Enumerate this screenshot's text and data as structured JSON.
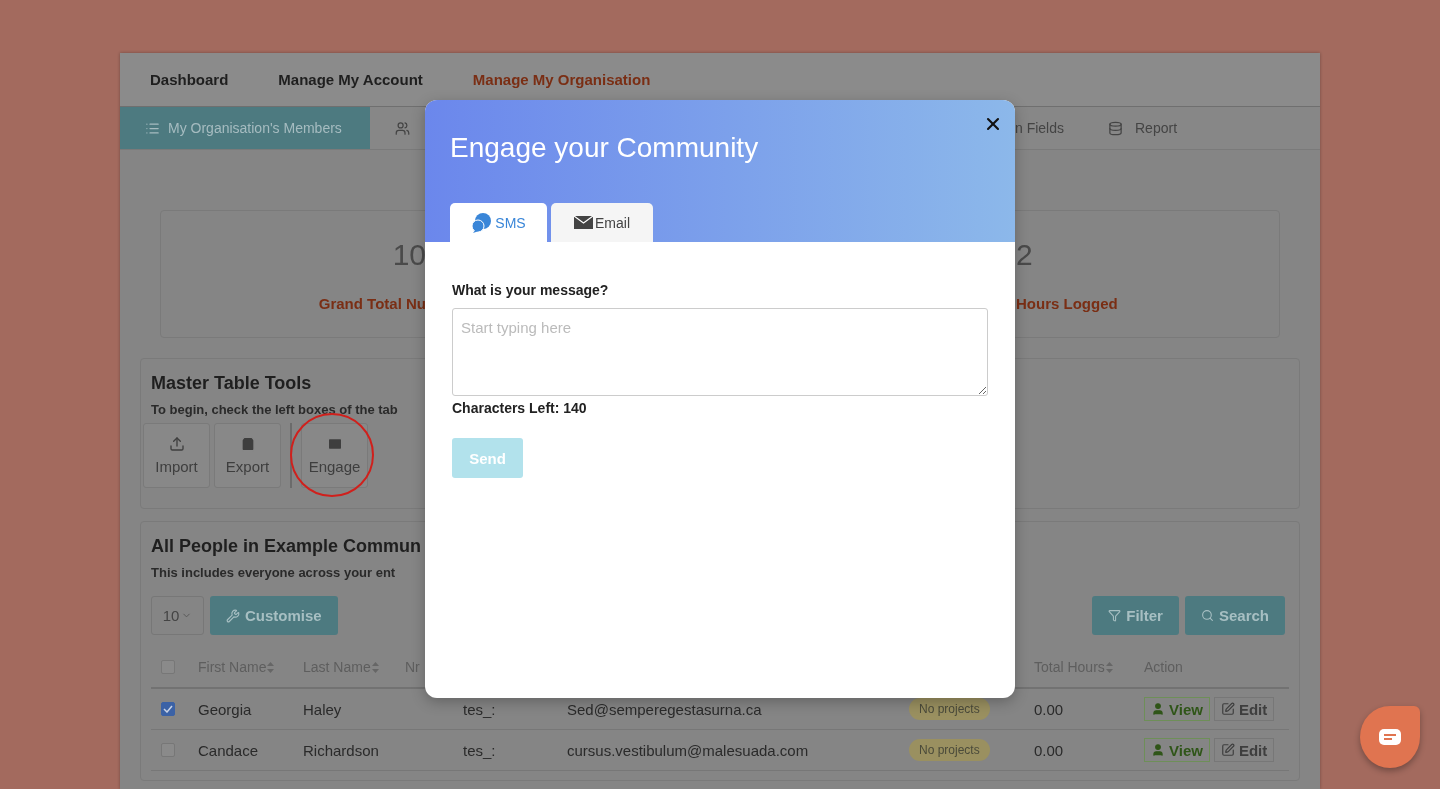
{
  "nav": {
    "items": [
      {
        "label": "Dashboard",
        "selected": false
      },
      {
        "label": "Manage My Account",
        "selected": false
      },
      {
        "label": "Manage My Organisation",
        "selected": true
      }
    ]
  },
  "subnav": {
    "items": [
      {
        "label": "My Organisation's Members",
        "selected": true
      },
      {
        "selected": false
      },
      {
        "label": "n Fields",
        "selected": false
      },
      {
        "label": "Report",
        "selected": false
      }
    ]
  },
  "stats": [
    {
      "value": "10",
      "label": "Grand Total Nu"
    },
    {
      "value": "2",
      "label": "Hours Logged"
    }
  ],
  "tools": {
    "title": "Master Table Tools",
    "hint": "To begin, check the left boxes of the tab",
    "buttons": [
      {
        "label": "Import",
        "highlighted": false
      },
      {
        "label": "Export",
        "highlighted": false
      },
      {
        "label": "Engage",
        "highlighted": true
      }
    ]
  },
  "people": {
    "title": "All People in Example Commun",
    "subtitle": "This includes everyone across your ent",
    "page_size": "10",
    "customise": "Customise",
    "filter": "Filter",
    "search": "Search",
    "all_checked": false,
    "columns": [
      {
        "label": "First Name",
        "sortable": true
      },
      {
        "label": "Last Name",
        "sortable": true
      },
      {
        "label": "Nr",
        "sortable": false
      },
      {
        "label": "Total Hours",
        "sortable": true
      },
      {
        "label": "Action",
        "sortable": false
      }
    ],
    "rows": [
      {
        "checked": true,
        "first": "Georgia",
        "last": "Haley",
        "column_5": "tes_:",
        "email": "Sed@semperegestasurna.ca",
        "projects": "No projects",
        "hours": "0.00",
        "actions": [
          "View",
          "Edit"
        ]
      },
      {
        "checked": false,
        "first": "Candace",
        "last": "Richardson",
        "column_5": "tes_:",
        "email": "cursus.vestibulum@malesuada.com",
        "projects": "No projects",
        "hours": "0.00",
        "actions": [
          "View",
          "Edit"
        ]
      }
    ]
  },
  "modal": {
    "title": "Engage your Community",
    "tabs": [
      {
        "label": "SMS",
        "selected": true
      },
      {
        "label": "Email",
        "selected": false
      }
    ],
    "question": "What is your message?",
    "message": {
      "placeholder": "Start typing here"
    },
    "counter": "Characters Left: 140",
    "send": {
      "label": "Send",
      "disabled": true
    }
  }
}
